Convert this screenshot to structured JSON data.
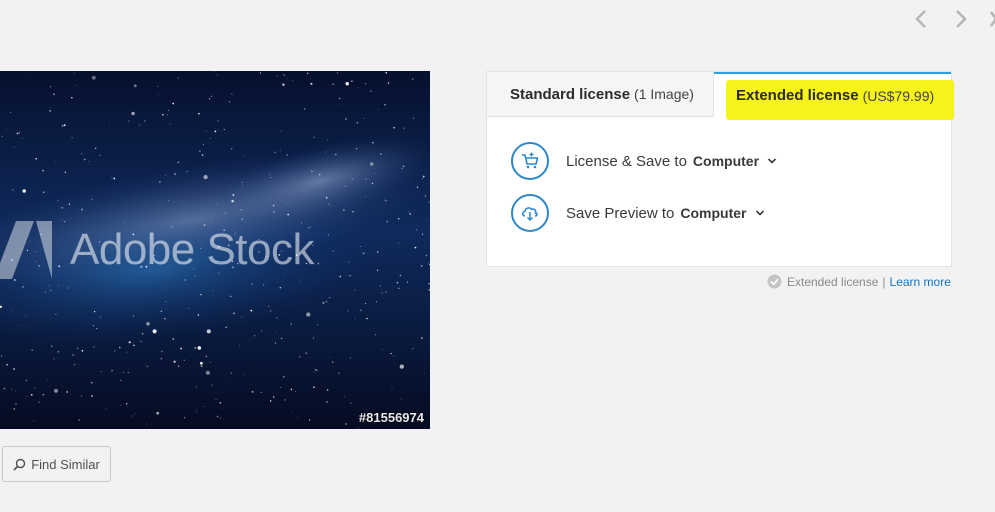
{
  "nav": {
    "prev_icon": "chevron-left-icon",
    "next_icon": "chevron-right-icon",
    "close_icon": "close-icon"
  },
  "preview": {
    "watermark": "Adobe Stock",
    "asset_id": "#81556974"
  },
  "find_similar": {
    "label": "Find Similar",
    "icon": "search-icon"
  },
  "license": {
    "tabs": [
      {
        "label": "Standard license",
        "sub": "(1 Image)"
      },
      {
        "label": "Extended license",
        "sub": "(US$79.99)"
      }
    ],
    "highlight_color": "#f6f31b",
    "accent_color": "#2d9fd9",
    "actions": [
      {
        "text": "License & Save to",
        "dest": "Computer",
        "icon": "cart-icon"
      },
      {
        "text": "Save Preview to",
        "dest": "Computer",
        "icon": "cloud-download-icon"
      }
    ]
  },
  "extended_note": {
    "text": "Extended license",
    "separator": "|",
    "link": "Learn more"
  }
}
